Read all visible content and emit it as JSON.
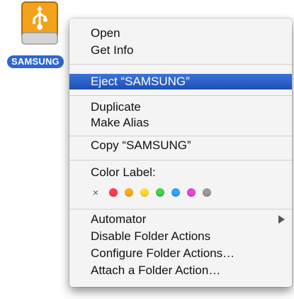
{
  "drive": {
    "label": "SAMSUNG",
    "icon": "usb-drive-icon"
  },
  "menu": {
    "items": [
      {
        "label": "Open"
      },
      {
        "label": "Get Info"
      },
      {
        "label": "Eject “SAMSUNG”",
        "selected": true
      },
      {
        "label": "Duplicate"
      },
      {
        "label": "Make Alias"
      },
      {
        "label": "Copy “SAMSUNG”"
      },
      {
        "label": "Color Label:"
      },
      {
        "label": "Automator",
        "has_submenu": true
      },
      {
        "label": "Disable Folder Actions"
      },
      {
        "label": "Configure Folder Actions…"
      },
      {
        "label": "Attach a Folder Action…"
      }
    ],
    "color_labels": {
      "none_symbol": "×",
      "colors": [
        "#ff3b52",
        "#ffae1a",
        "#ffe12a",
        "#48d148",
        "#2aa8ff",
        "#e04ad8",
        "#9a9a9a"
      ]
    }
  }
}
